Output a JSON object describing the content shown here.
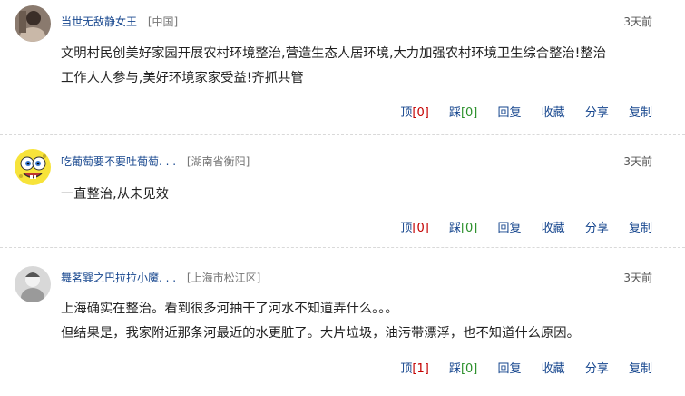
{
  "comments": [
    {
      "username": "当世无敌静女王",
      "location": "[中国]",
      "time": "3天前",
      "lines": [
        "文明村民创美好家园开展农村环境整治,营造生态人居环境,大力加强农村环境卫生综合整治!整治",
        "工作人人参与,美好环境家家受益!齐抓共管"
      ],
      "up_label": "顶",
      "up_count": "[0]",
      "down_label": "踩",
      "down_count": "[0]",
      "reply": "回复",
      "favorite": "收藏",
      "share": "分享",
      "copy": "复制"
    },
    {
      "username": "吃葡萄要不要吐葡萄. . .",
      "location": "[湖南省衡阳]",
      "time": "3天前",
      "lines": [
        "一直整治,从未见效"
      ],
      "up_label": "顶",
      "up_count": "[0]",
      "down_label": "踩",
      "down_count": "[0]",
      "reply": "回复",
      "favorite": "收藏",
      "share": "分享",
      "copy": "复制"
    },
    {
      "username": "舞茗巽之巴拉拉小魔. . .",
      "location": "[上海市松江区]",
      "time": "3天前",
      "lines": [
        "上海确实在整治。看到很多河抽干了河水不知道弄什么。。。",
        "但结果是，我家附近那条河最近的水更脏了。大片垃圾，油污带漂浮，也不知道什么原因。"
      ],
      "up_label": "顶",
      "up_count": "[1]",
      "down_label": "踩",
      "down_count": "[0]",
      "reply": "回复",
      "favorite": "收藏",
      "share": "分享",
      "copy": "复制"
    }
  ]
}
